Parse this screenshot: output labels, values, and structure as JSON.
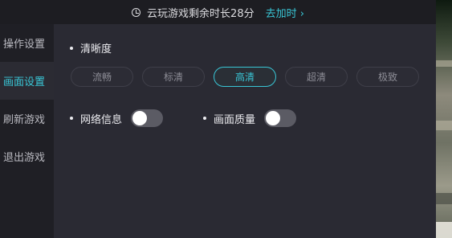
{
  "topbar": {
    "remaining_text": "云玩游戏剩余时长28分",
    "add_time_label": "去加时 ›"
  },
  "sidebar": {
    "items": [
      {
        "label": "操作设置"
      },
      {
        "label": "画面设置"
      },
      {
        "label": "刷新游戏"
      },
      {
        "label": "退出游戏"
      }
    ],
    "active_index": 1
  },
  "settings": {
    "resolution_title": "清晰度",
    "resolution_options": [
      "流畅",
      "标清",
      "高清",
      "超清",
      "极致"
    ],
    "selected_resolution": "高清",
    "network_info_label": "网络信息",
    "network_info_on": false,
    "quality_label": "画面质量",
    "quality_on": false
  },
  "colors": {
    "accent": "#39c6d6",
    "panel": "#2a2a33",
    "sidebar": "#1f1f25"
  }
}
